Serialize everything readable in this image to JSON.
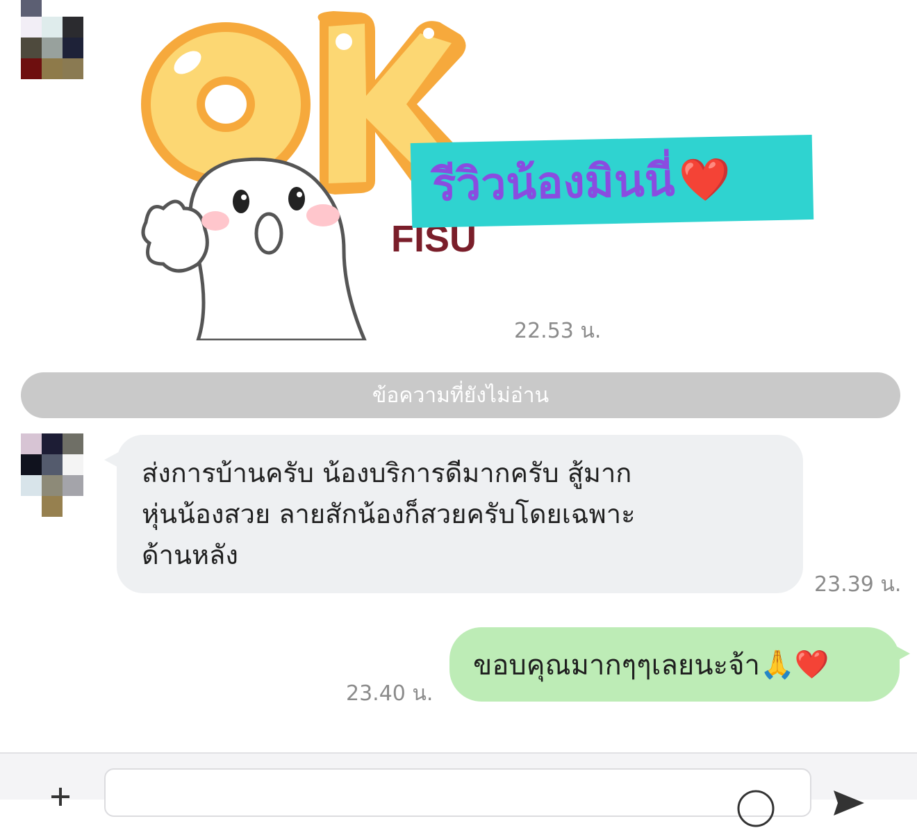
{
  "conversation": {
    "sticker": {
      "icon": "ok-sticker-icon",
      "overlay_text": "รีวิวน้องมินนี่",
      "overlay_emoji": "❤️",
      "time": "22.53 น."
    },
    "unread_divider": "ข้อความที่ยังไม่อ่าน",
    "incoming": {
      "lines": [
        "ส่งการบ้านครับ น้องบริการดีมากครับ สู้มาก",
        "หุ่นน้องสวย ลายสักน้องก็สวยครับโดยเฉพาะ",
        "ด้านหลัง"
      ],
      "time": "23.39 น."
    },
    "outgoing": {
      "text": "ขอบคุณมากๆๆเลยนะจ้า",
      "emoji_1": "🙏",
      "emoji_2": "❤️",
      "time": "23.40 น."
    }
  },
  "composer": {
    "plus_icon": "plus-icon",
    "emoji_icon": "emoji-icon",
    "send_icon": "send-icon"
  },
  "colors": {
    "incoming_bubble": "#eef0f2",
    "outgoing_bubble": "#bdecb6",
    "unread_bar": "#c9c9c9",
    "tag_background": "#2fd3d0",
    "tag_text": "#8a4ce0"
  }
}
